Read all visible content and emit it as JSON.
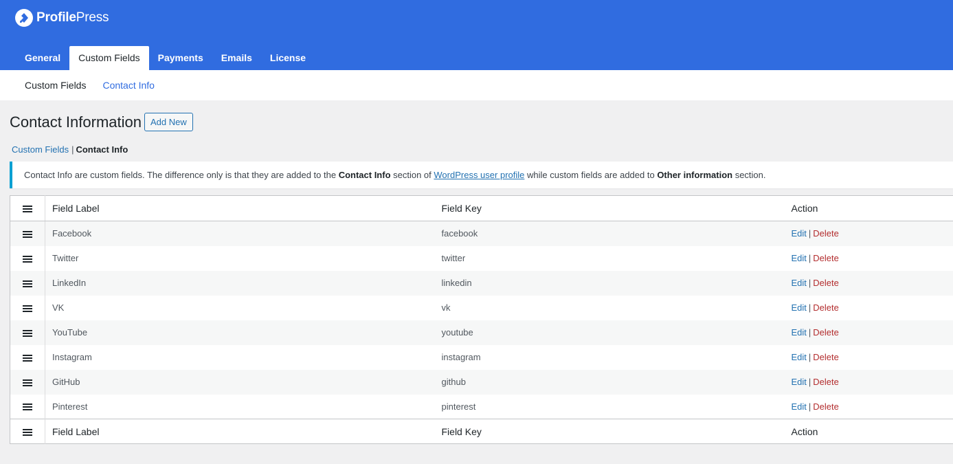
{
  "brand": {
    "name_bold": "Profile",
    "name_rest": "Press",
    "color": "#306ce0",
    "icon": "profilepress-logo-icon"
  },
  "tabs": [
    {
      "label": "General",
      "active": false
    },
    {
      "label": "Custom Fields",
      "active": true
    },
    {
      "label": "Payments",
      "active": false
    },
    {
      "label": "Emails",
      "active": false
    },
    {
      "label": "License",
      "active": false
    }
  ],
  "subnav": {
    "items": [
      {
        "label": "Custom Fields",
        "current": true
      },
      {
        "label": "Contact Info",
        "current": false
      }
    ]
  },
  "page": {
    "title": "Contact Information",
    "add_new": "Add New"
  },
  "breadcrumb": {
    "link": "Custom Fields",
    "separator": "|",
    "current": "Contact Info"
  },
  "notice": {
    "text1": "Contact Info are custom fields. The difference only is that they are added to the ",
    "bold1": "Contact Info",
    "text2": " section of ",
    "link": "WordPress user profile",
    "text3": " while custom fields are added to ",
    "bold2": "Other information",
    "text4": " section.",
    "accent_color": "#00a0d2"
  },
  "table": {
    "columns": {
      "label": "Field Label",
      "key": "Field Key",
      "action": "Action"
    },
    "actions": {
      "edit": "Edit",
      "sep": "|",
      "delete": "Delete"
    },
    "rows": [
      {
        "label": "Facebook",
        "key": "facebook"
      },
      {
        "label": "Twitter",
        "key": "twitter"
      },
      {
        "label": "LinkedIn",
        "key": "linkedin"
      },
      {
        "label": "VK",
        "key": "vk"
      },
      {
        "label": "YouTube",
        "key": "youtube"
      },
      {
        "label": "Instagram",
        "key": "instagram"
      },
      {
        "label": "GitHub",
        "key": "github"
      },
      {
        "label": "Pinterest",
        "key": "pinterest"
      }
    ]
  }
}
